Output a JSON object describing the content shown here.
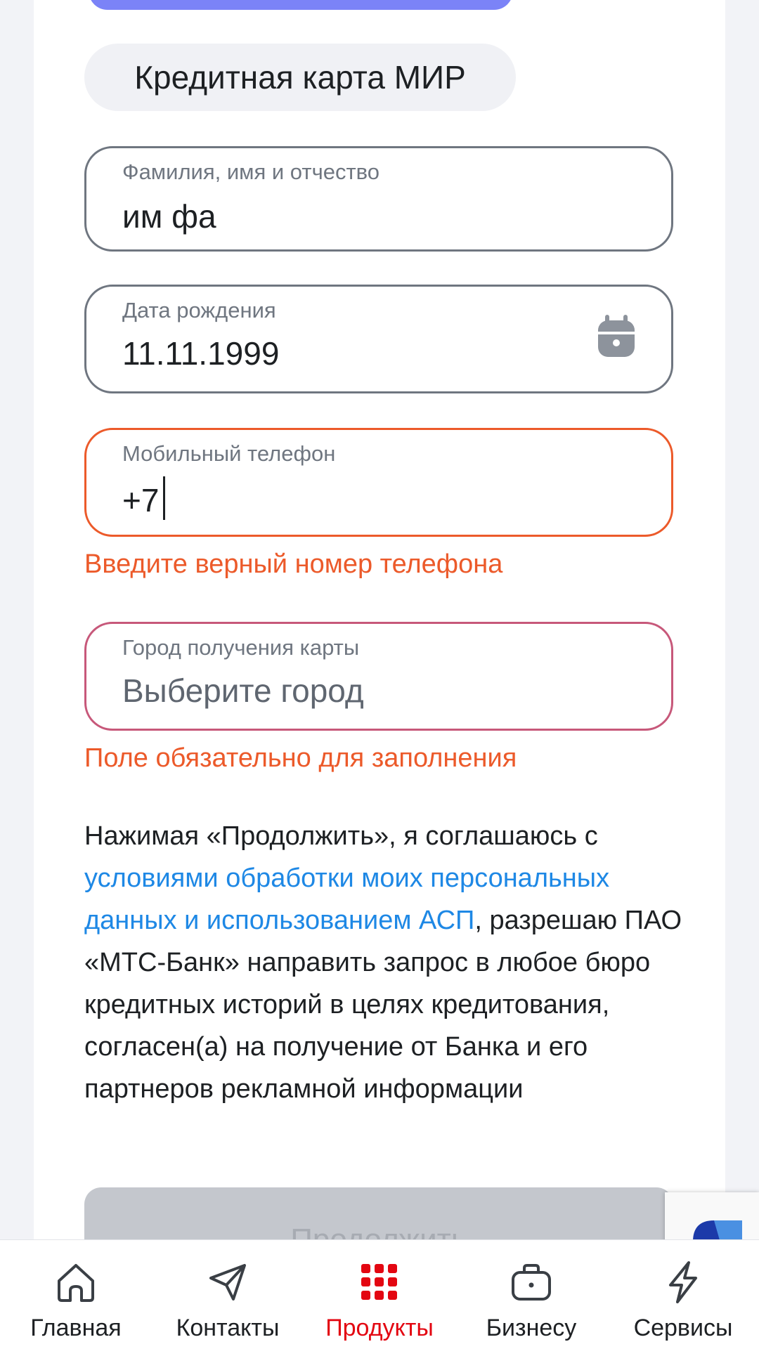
{
  "product_chip": "Кредитная карта МИР",
  "fields": {
    "fio": {
      "label": "Фамилия, имя и отчество",
      "value": "им фа"
    },
    "birth": {
      "label": "Дата рождения",
      "value": "11.11.1999"
    },
    "phone": {
      "label": "Мобильный телефон",
      "value": "+7",
      "error": "Введите верный номер телефона"
    },
    "city": {
      "label": "Город получения карты",
      "placeholder": "Выберите город",
      "error": "Поле обязательно для заполнения"
    }
  },
  "consent": {
    "part1": "Нажимая «Продолжить», я соглашаюсь с ",
    "link": "условиями обработки моих персональных данных и использованием АСП",
    "part2": ", разрешаю ПАО «МТС-Банк» направить запрос в любое бюро кредитных историй в целях кредитования, согласен(а) на получение от Банка и его партнеров рекламной информации"
  },
  "continue_button": "Продолжить",
  "nav": [
    {
      "label": "Главная",
      "icon": "home-icon",
      "active": false
    },
    {
      "label": "Контакты",
      "icon": "send-icon",
      "active": false
    },
    {
      "label": "Продукты",
      "icon": "grid-icon",
      "active": true
    },
    {
      "label": "Бизнесу",
      "icon": "briefcase-icon",
      "active": false
    },
    {
      "label": "Сервисы",
      "icon": "lightning-icon",
      "active": false
    }
  ],
  "colors": {
    "accent_red": "#e30611",
    "error": "#ec5a2a",
    "link": "#1e88e5",
    "purple": "#7b83f7"
  }
}
